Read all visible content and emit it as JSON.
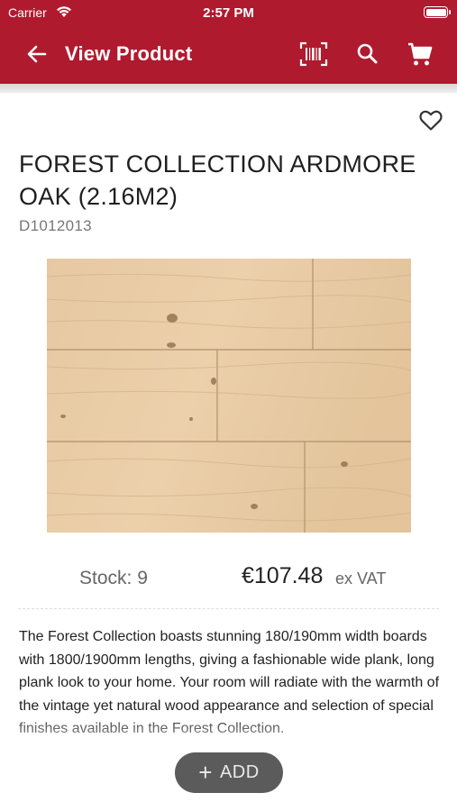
{
  "status_bar": {
    "carrier": "Carrier",
    "time": "2:57 PM"
  },
  "nav": {
    "title": "View Product",
    "icons": [
      "back-arrow-icon",
      "barcode-scan-icon",
      "search-icon",
      "cart-icon"
    ]
  },
  "product": {
    "title": "FOREST COLLECTION ARDMORE OAK (2.16M2)",
    "sku": "D1012013",
    "stock": "Stock: 9",
    "price": "€107.48",
    "price_suffix": "ex VAT",
    "description": "The Forest Collection boasts stunning 180/190mm width boards with 1800/1900mm lengths, giving a fashionable wide plank, long plank look to your home. Your room will radiate with the warmth of the vintage yet natural wood appearance and selection of special finishes available in the Forest Collection."
  },
  "actions": {
    "add_label": "ADD",
    "add_icon": "plus-icon",
    "favorite_icon": "heart-outline-icon"
  },
  "colors": {
    "brand": "#b01a2e",
    "add_button": "#5b5b5b"
  }
}
